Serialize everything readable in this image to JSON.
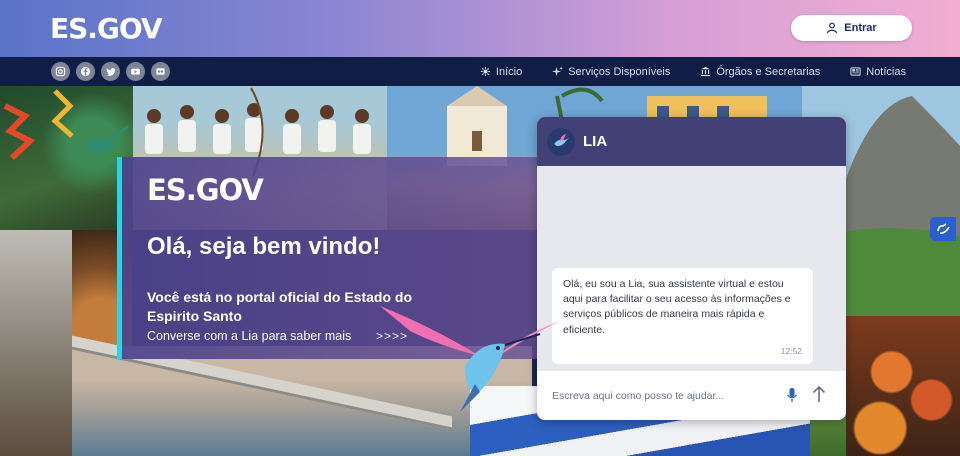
{
  "header": {
    "logo": "ES.GOV",
    "login_label": "Entrar"
  },
  "social_icons": [
    "instagram-icon",
    "facebook-icon",
    "twitter-icon",
    "youtube-icon",
    "flickr-icon"
  ],
  "nav": [
    {
      "label": "Início",
      "icon": "home-icon"
    },
    {
      "label": "Serviços Disponíveis",
      "icon": "sparkle-icon"
    },
    {
      "label": "Órgãos e Secretarias",
      "icon": "institution-icon"
    },
    {
      "label": "Notícias",
      "icon": "news-icon"
    }
  ],
  "welcome": {
    "logo": "ES.GOV",
    "title": "Olá, seja bem vindo!",
    "subtitle": "Você está no portal oficial do Estado do Espirito Santo",
    "cta": "Converse com a Lia para saber mais",
    "arrows": ">>>>"
  },
  "chat": {
    "title": "LIA",
    "message": "Olá, eu sou a Lia, sua assistente virtual e estou aqui para facilitar o seu acesso às informações e serviços públicos de maneira mais rápida e eficiente.",
    "time": "12:52",
    "input_placeholder": "Escreva aqui como posso te ajudar..."
  },
  "colors": {
    "accent": "#2ad3e6",
    "navbar": "#101d45",
    "chat_header": "#414077"
  }
}
